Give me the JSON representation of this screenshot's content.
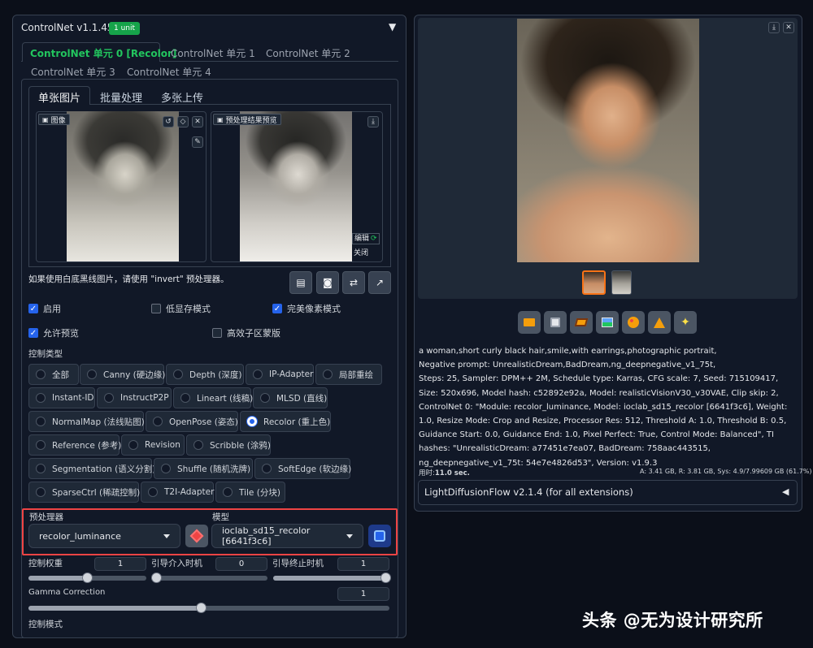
{
  "controlnet": {
    "title": "ControlNet v1.1.454",
    "unit_badge": "1 unit",
    "collapse_glyph": "▼",
    "unit_tabs": [
      {
        "label": "ControlNet 单元 0 [Recolor]"
      },
      {
        "label": "ControlNet 单元 1"
      },
      {
        "label": "ControlNet 单元 2"
      },
      {
        "label": "ControlNet 单元 3"
      },
      {
        "label": "ControlNet 单元 4"
      }
    ],
    "image_tabs": [
      {
        "label": "单张图片"
      },
      {
        "label": "批量处理"
      },
      {
        "label": "多张上传"
      }
    ],
    "image_label": "图像",
    "preview_label": "预处理结果预览",
    "edit_label": "编辑",
    "close_label": "关闭",
    "invert_hint": "如果使用白底黑线图片，请使用 \"invert\" 预处理器。",
    "checkboxes": [
      {
        "label": "启用",
        "checked": true
      },
      {
        "label": "低显存模式",
        "checked": false
      },
      {
        "label": "完美像素模式",
        "checked": true
      },
      {
        "label": "允许预览",
        "checked": true
      },
      {
        "label": "高效子区蒙版",
        "checked": false
      }
    ],
    "control_type_label": "控制类型",
    "control_types": [
      {
        "label": "全部"
      },
      {
        "label": "Canny (硬边缘)"
      },
      {
        "label": "Depth (深度)"
      },
      {
        "label": "IP-Adapter"
      },
      {
        "label": "局部重绘"
      },
      {
        "label": "Instant-ID"
      },
      {
        "label": "InstructP2P"
      },
      {
        "label": "Lineart (线稿)"
      },
      {
        "label": "MLSD (直线)"
      },
      {
        "label": "NormalMap (法线贴图)"
      },
      {
        "label": "OpenPose (姿态)"
      },
      {
        "label": "Recolor (重上色)"
      },
      {
        "label": "Reference (参考)"
      },
      {
        "label": "Revision"
      },
      {
        "label": "Scribble (涂鸦)"
      },
      {
        "label": "Segmentation (语义分割)"
      },
      {
        "label": "Shuffle (随机洗牌)"
      },
      {
        "label": "SoftEdge (软边缘)"
      },
      {
        "label": "SparseCtrl (稀疏控制)"
      },
      {
        "label": "T2I-Adapter"
      },
      {
        "label": "Tile (分块)"
      }
    ],
    "selected_control_type": "Recolor (重上色)",
    "preprocessor_label": "预处理器",
    "preprocessor_value": "recolor_luminance",
    "model_label": "模型",
    "model_value": "ioclab_sd15_recolor [6641f3c6]",
    "control_weight_label": "控制权重",
    "control_weight": "1",
    "start_step_label": "引导介入时机",
    "start_step": "0",
    "end_step_label": "引导终止时机",
    "end_step": "1",
    "gamma_label": "Gamma Correction",
    "gamma": "1",
    "control_mode_label": "控制模式"
  },
  "output": {
    "generation_info": "a woman,short curly black hair,smile,with earrings,photographic portrait,\nNegative prompt: UnrealisticDream,BadDream,ng_deepnegative_v1_75t,\nSteps: 25, Sampler: DPM++ 2M, Schedule type: Karras, CFG scale: 7, Seed: 715109417, Size: 520x696, Model hash: c52892e92a, Model: realisticVisionV30_v30VAE, Clip skip: 2, ControlNet 0: \"Module: recolor_luminance, Model: ioclab_sd15_recolor [6641f3c6], Weight: 1.0, Resize Mode: Crop and Resize, Processor Res: 512, Threshold A: 1.0, Threshold B: 0.5, Guidance Start: 0.0, Guidance End: 1.0, Pixel Perfect: True, Control Mode: Balanced\", TI hashes: \"UnrealisticDream: a77451e7ea07, BadDream: 758aac443515, ng_deepnegative_v1_75t: 54e7e4826d53\", Version: v1.9.3",
    "time_label": "用时:",
    "time_value": "11.0 sec.",
    "vram": "A: 3.41 GB, R: 3.81 GB, Sys: 4.9/7.99609 GB (61.7%)",
    "diffusion_flow": "LightDiffusionFlow v2.1.4 (for all extensions)",
    "diffusion_flow_glyph": "◀"
  },
  "watermark": "头条 @无为设计研究所",
  "colors": {
    "accent_green": "#22c55e",
    "badge_green": "#16a34a",
    "checkbox_blue": "#2563eb",
    "highlight_red": "#ef4444",
    "panel_bg": "#111827",
    "page_bg": "#0b0f19"
  },
  "icons": [
    "image-icon",
    "undo-icon",
    "eraser-icon",
    "close-icon",
    "download-icon",
    "brush-icon",
    "refresh-icon",
    "folder-icon",
    "save-icon",
    "zip-icon",
    "picture-icon",
    "palette-icon",
    "ruler-icon",
    "sparkle-icon",
    "explosion-icon"
  ]
}
